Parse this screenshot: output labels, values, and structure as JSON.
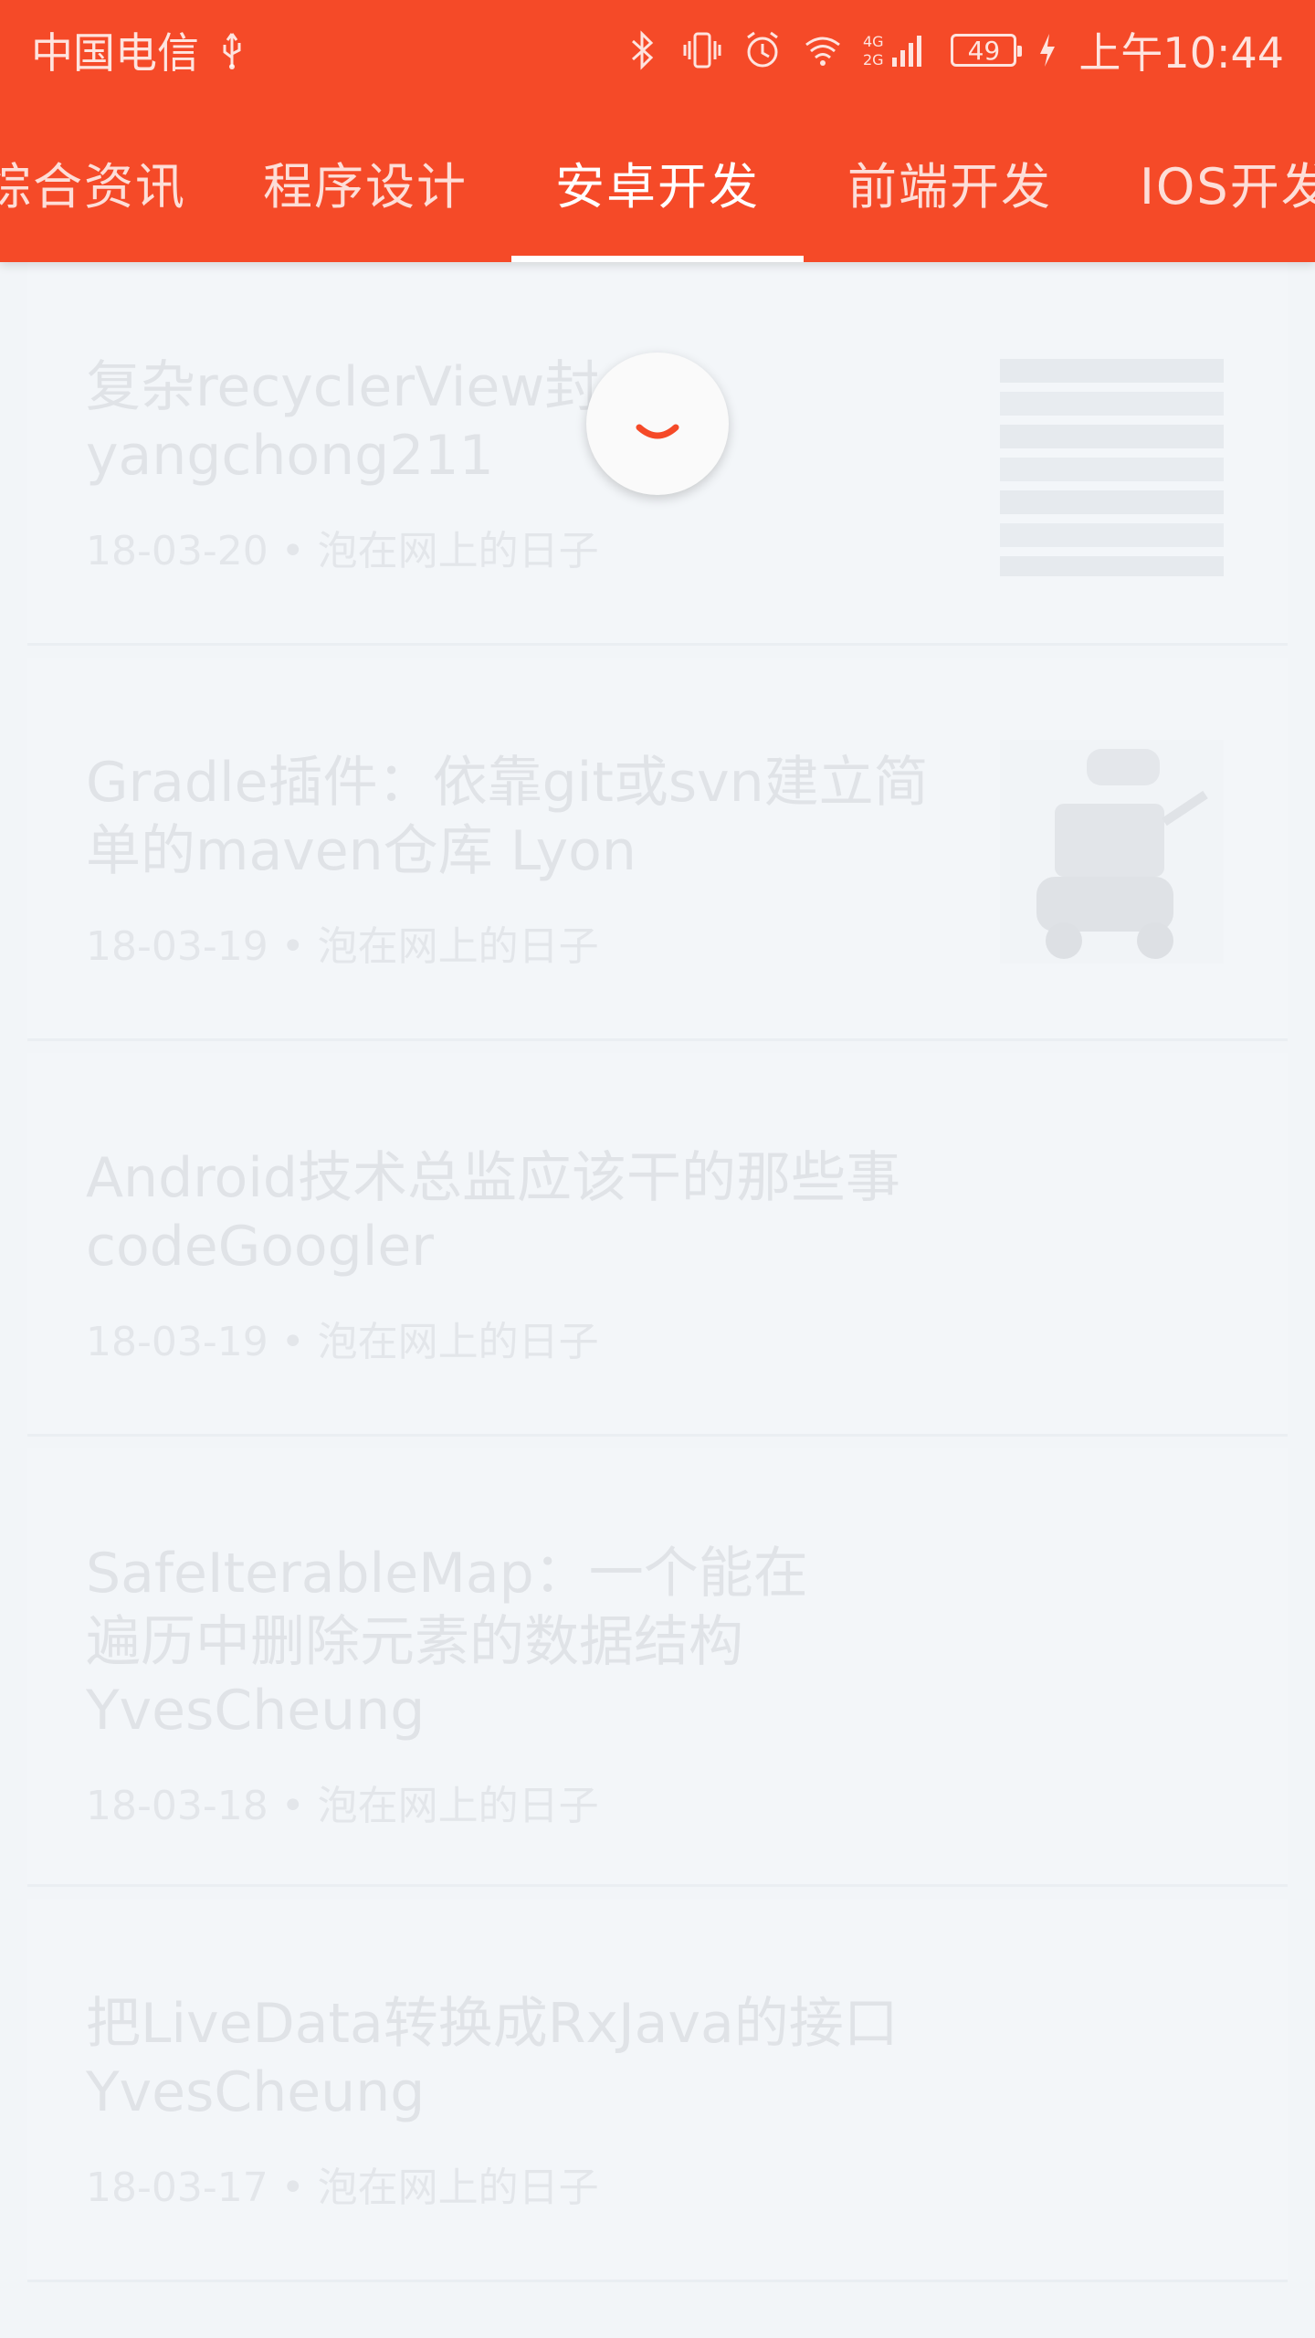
{
  "status_bar": {
    "carrier": "中国电信",
    "battery": "49",
    "time": "上午10:44",
    "icons": [
      "usb-icon",
      "bluetooth-icon",
      "vibrate-icon",
      "alarm-icon",
      "wifi-icon",
      "signal-icon",
      "battery-icon",
      "charging-icon"
    ]
  },
  "tabs": [
    {
      "label": "综合资讯"
    },
    {
      "label": "程序设计"
    },
    {
      "label": "安卓开发"
    },
    {
      "label": "前端开发"
    },
    {
      "label": "IOS开发"
    }
  ],
  "active_tab": "安卓开发",
  "articles": [
    {
      "title_line1": "复杂recyclerView封",
      "title_line2": "yangchong211",
      "meta": "18-03-20 • 泡在网上的日子",
      "thumbnail": "code-screenshot"
    },
    {
      "title_line1": "Gradle插件：依靠git或svn建立简",
      "title_line2": "单的maven仓库 Lyon",
      "meta": "18-03-19 • 泡在网上的日子",
      "thumbnail": "robot-illustration"
    },
    {
      "title_line1": "Android技术总监应该干的那些事",
      "title_line2": "codeGoogler",
      "meta": "18-03-19 • 泡在网上的日子"
    },
    {
      "title_line1": "SafeIterableMap：一个能在",
      "title_line2": "遍历中删除元素的数据结构",
      "title_line3": "YvesCheung",
      "meta": "18-03-18 • 泡在网上的日子"
    },
    {
      "title_line1": "把LiveData转换成RxJava的接口",
      "title_line2": "YvesCheung",
      "meta": "18-03-17 • 泡在网上的日子"
    }
  ],
  "colors": {
    "accent": "#f54a28",
    "background": "#f2f5f8",
    "faded_text": "#e0e3e7",
    "spinner": "#f54a28"
  }
}
